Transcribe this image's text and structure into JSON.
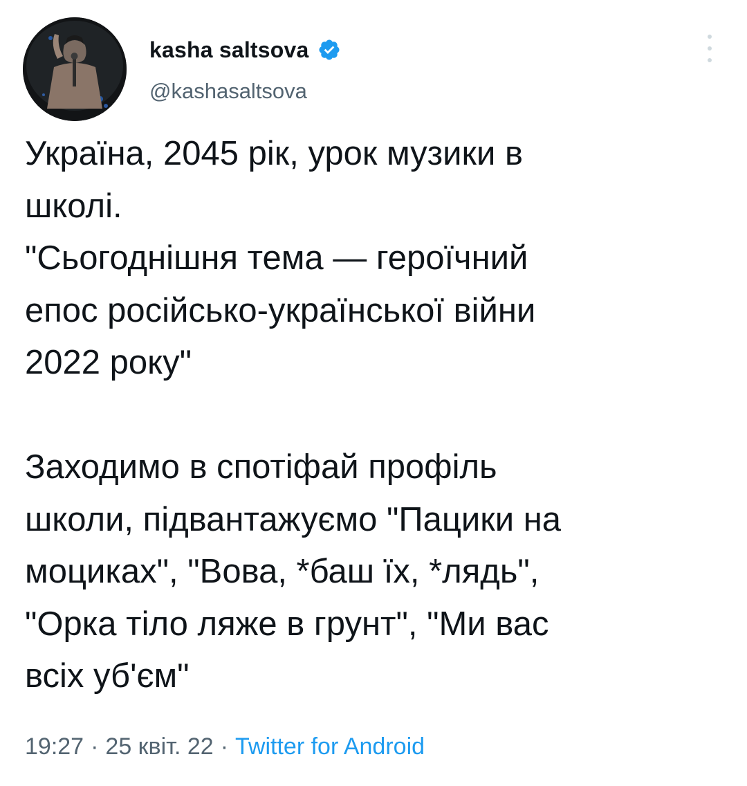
{
  "author": {
    "display_name": "kasha saltsova",
    "handle": "@kashasaltsova",
    "verified": true,
    "avatar_icon": "profile-photo"
  },
  "tweet": {
    "text": "Україна, 2045 рік, урок музики в\nшколі.\n\"Сьогоднішня тема — героїчний\nепос російсько-української війни\n2022 року\"\n\nЗаходимо в спотіфай профіль\nшколи, підвантажуємо \"Пацики на\nмоциках\", \"Вова, *баш їх, *лядь\",\n\"Орка тіло ляже в грунт\", \"Ми вас\nвсіх уб'єм\"",
    "time": "19:27",
    "date": "25 квіт. 22",
    "separator": "·",
    "source": "Twitter for Android"
  },
  "icons": {
    "verified": "verified-badge-icon",
    "more": "more-vertical-icon"
  },
  "colors": {
    "accent": "#1d9bf0",
    "text": "#0f1419",
    "secondary": "#536471"
  }
}
